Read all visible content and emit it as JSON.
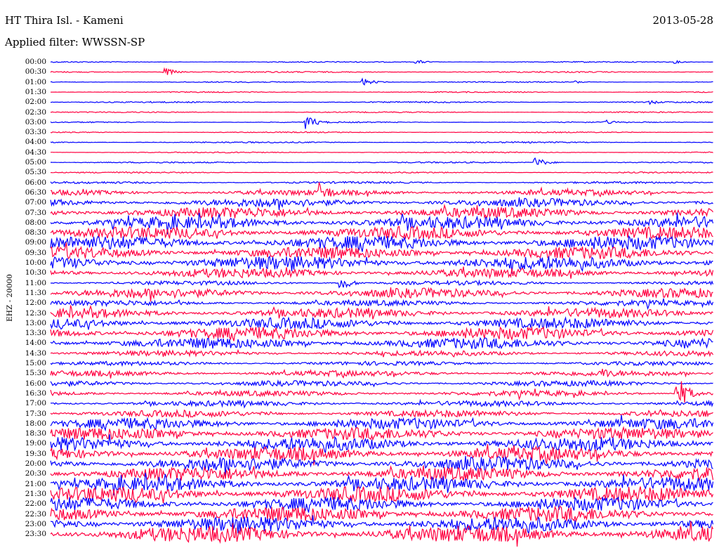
{
  "header": {
    "station": "HT Thira Isl. - Kameni",
    "date": "2013-05-28",
    "filter": "Applied filter: WWSSN-SP"
  },
  "chart_data": {
    "type": "line",
    "title": "HT Thira Isl. - Kameni",
    "ylabel": "EHZ - 20000",
    "minutes_per_row": 30,
    "colors": {
      "blue": "#0000ff",
      "red": "#ff0040"
    },
    "rows": [
      {
        "label": "00:00",
        "color": "blue",
        "amp": 0.8,
        "events": [
          {
            "t": 16.6,
            "amp": 3
          },
          {
            "t": 28.3,
            "amp": 2
          }
        ]
      },
      {
        "label": "00:30",
        "color": "red",
        "amp": 1,
        "events": [
          {
            "t": 5.2,
            "amp": 6
          }
        ]
      },
      {
        "label": "01:00",
        "color": "blue",
        "amp": 0.8,
        "events": [
          {
            "t": 14.2,
            "amp": 5
          },
          {
            "t": 23.8,
            "amp": 2
          }
        ]
      },
      {
        "label": "01:30",
        "color": "red",
        "amp": 0.8,
        "events": []
      },
      {
        "label": "02:00",
        "color": "blue",
        "amp": 1,
        "events": [
          {
            "t": 27.2,
            "amp": 3
          }
        ]
      },
      {
        "label": "02:30",
        "color": "red",
        "amp": 0.8,
        "events": []
      },
      {
        "label": "03:00",
        "color": "blue",
        "amp": 0.8,
        "events": [
          {
            "t": 11.6,
            "amp": 10
          },
          {
            "t": 25.2,
            "amp": 3
          }
        ]
      },
      {
        "label": "03:30",
        "color": "red",
        "amp": 0.8,
        "events": []
      },
      {
        "label": "04:00",
        "color": "blue",
        "amp": 1,
        "events": []
      },
      {
        "label": "04:30",
        "color": "red",
        "amp": 0.8,
        "events": []
      },
      {
        "label": "05:00",
        "color": "blue",
        "amp": 1,
        "events": [
          {
            "t": 22,
            "amp": 7
          }
        ]
      },
      {
        "label": "05:30",
        "color": "red",
        "amp": 1,
        "events": []
      },
      {
        "label": "06:00",
        "color": "blue",
        "amp": 1.5,
        "events": []
      },
      {
        "label": "06:30",
        "color": "red",
        "amp": 4,
        "events": [
          {
            "t": 12.3,
            "amp": 15
          }
        ]
      },
      {
        "label": "07:00",
        "color": "blue",
        "amp": 6,
        "events": []
      },
      {
        "label": "07:30",
        "color": "red",
        "amp": 8,
        "events": []
      },
      {
        "label": "08:00",
        "color": "blue",
        "amp": 9,
        "events": []
      },
      {
        "label": "08:30",
        "color": "red",
        "amp": 9,
        "events": []
      },
      {
        "label": "09:00",
        "color": "blue",
        "amp": 10,
        "events": []
      },
      {
        "label": "09:30",
        "color": "red",
        "amp": 9,
        "events": []
      },
      {
        "label": "10:00",
        "color": "blue",
        "amp": 10,
        "events": []
      },
      {
        "label": "10:30",
        "color": "red",
        "amp": 7,
        "events": []
      },
      {
        "label": "11:00",
        "color": "blue",
        "amp": 3,
        "events": [
          {
            "t": 13.2,
            "amp": 10
          }
        ]
      },
      {
        "label": "11:30",
        "color": "red",
        "amp": 7,
        "events": []
      },
      {
        "label": "12:00",
        "color": "blue",
        "amp": 4,
        "events": []
      },
      {
        "label": "12:30",
        "color": "red",
        "amp": 7,
        "events": []
      },
      {
        "label": "13:00",
        "color": "blue",
        "amp": 8,
        "events": []
      },
      {
        "label": "13:30",
        "color": "red",
        "amp": 9,
        "events": []
      },
      {
        "label": "14:00",
        "color": "blue",
        "amp": 8,
        "events": []
      },
      {
        "label": "14:30",
        "color": "red",
        "amp": 4,
        "events": []
      },
      {
        "label": "15:00",
        "color": "blue",
        "amp": 3,
        "events": []
      },
      {
        "label": "15:30",
        "color": "red",
        "amp": 4,
        "events": [
          {
            "t": 25.1,
            "amp": 8
          }
        ]
      },
      {
        "label": "16:00",
        "color": "blue",
        "amp": 4,
        "events": []
      },
      {
        "label": "16:30",
        "color": "red",
        "amp": 4,
        "events": [
          {
            "t": 28.4,
            "amp": 25
          }
        ]
      },
      {
        "label": "17:00",
        "color": "blue",
        "amp": 4,
        "events": []
      },
      {
        "label": "17:30",
        "color": "red",
        "amp": 5,
        "events": []
      },
      {
        "label": "18:00",
        "color": "blue",
        "amp": 8,
        "events": []
      },
      {
        "label": "18:30",
        "color": "red",
        "amp": 9,
        "events": []
      },
      {
        "label": "19:00",
        "color": "blue",
        "amp": 10,
        "events": []
      },
      {
        "label": "19:30",
        "color": "red",
        "amp": 10,
        "events": []
      },
      {
        "label": "20:00",
        "color": "blue",
        "amp": 10,
        "events": []
      },
      {
        "label": "20:30",
        "color": "red",
        "amp": 10,
        "events": []
      },
      {
        "label": "21:00",
        "color": "blue",
        "amp": 10,
        "events": []
      },
      {
        "label": "21:30",
        "color": "red",
        "amp": 11,
        "events": []
      },
      {
        "label": "22:00",
        "color": "blue",
        "amp": 10,
        "events": []
      },
      {
        "label": "22:30",
        "color": "red",
        "amp": 11,
        "events": []
      },
      {
        "label": "23:00",
        "color": "blue",
        "amp": 11,
        "events": []
      },
      {
        "label": "23:30",
        "color": "red",
        "amp": 12,
        "events": []
      }
    ]
  }
}
